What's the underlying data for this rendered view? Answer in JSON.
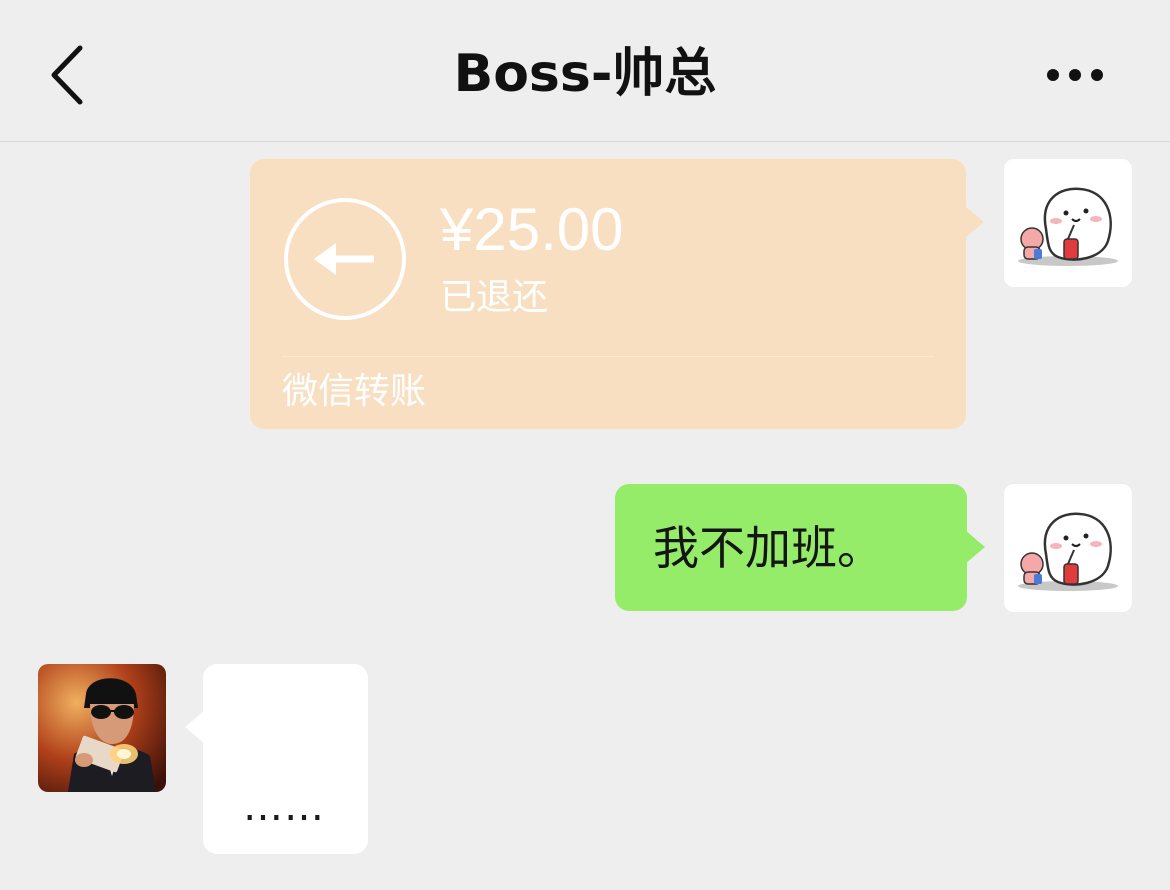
{
  "header": {
    "title": "Boss-帅总",
    "back_icon": "chevron-left-icon",
    "more_icon": "ellipsis-icon"
  },
  "messages": [
    {
      "type": "transfer",
      "sender": "me",
      "amount": "¥25.00",
      "status": "已退还",
      "service": "微信转账",
      "icon": "refund-arrow-icon",
      "color": "#f9dfc2"
    },
    {
      "type": "text",
      "sender": "me",
      "text": "我不加班。",
      "color": "#95ec69"
    },
    {
      "type": "text",
      "sender": "boss",
      "text": "……",
      "color": "#ffffff"
    }
  ]
}
